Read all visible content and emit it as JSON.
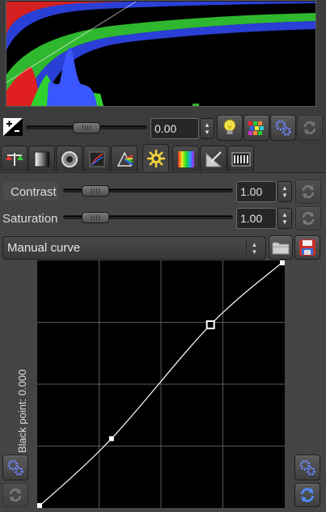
{
  "toolbar": {
    "exposure_value": "0.00"
  },
  "tabs": [
    {
      "name": "exposure-tab"
    },
    {
      "name": "black-white-tab"
    },
    {
      "name": "lens-tab"
    },
    {
      "name": "raw-tab"
    },
    {
      "name": "color-tab"
    },
    {
      "name": "transform-tab"
    },
    {
      "name": "spectrum-tab"
    },
    {
      "name": "geometry-tab"
    },
    {
      "name": "metadata-tab"
    }
  ],
  "adjustments": {
    "contrast": {
      "label": "Contrast",
      "value": "1.00",
      "level": 0.13
    },
    "saturation": {
      "label": "Saturation",
      "value": "1.00",
      "level": 0.13
    }
  },
  "exposure_slider_level": 0.5,
  "curve": {
    "type_label": "Manual curve",
    "black_point_label": "Black point: 0.000",
    "points": [
      [
        0,
        0
      ],
      [
        0.3,
        0.28
      ],
      [
        0.7,
        0.74
      ],
      [
        1,
        1
      ]
    ]
  },
  "colors": {
    "background": "#3c3c3c",
    "panel": "#444444",
    "grid": "#5a5a5a",
    "curve": "#ffffff"
  }
}
